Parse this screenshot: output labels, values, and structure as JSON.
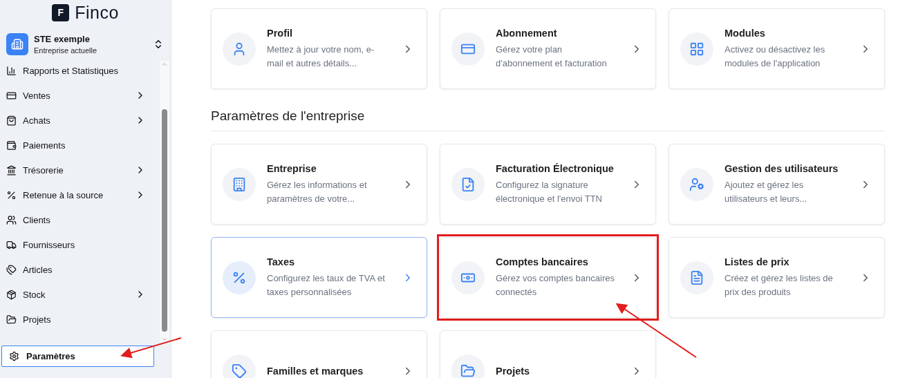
{
  "logo": {
    "mark": "F",
    "name": "Finco"
  },
  "company": {
    "name": "STE exemple",
    "subtitle": "Entreprise actuelle"
  },
  "sidebar": {
    "items": [
      {
        "label": "Rapports et Statistiques",
        "submenu": false,
        "selected": false
      },
      {
        "label": "Ventes",
        "submenu": true,
        "selected": false
      },
      {
        "label": "Achats",
        "submenu": true,
        "selected": false
      },
      {
        "label": "Paiements",
        "submenu": false,
        "selected": false
      },
      {
        "label": "Trésorerie",
        "submenu": true,
        "selected": false
      },
      {
        "label": "Retenue à la source",
        "submenu": true,
        "selected": false
      },
      {
        "label": "Clients",
        "submenu": false,
        "selected": false
      },
      {
        "label": "Fournisseurs",
        "submenu": false,
        "selected": false
      },
      {
        "label": "Articles",
        "submenu": false,
        "selected": false
      },
      {
        "label": "Stock",
        "submenu": true,
        "selected": false
      },
      {
        "label": "Projets",
        "submenu": false,
        "selected": false
      }
    ],
    "footer_item": {
      "label": "Paramètres",
      "selected": true
    }
  },
  "sections": [
    {
      "cards": [
        {
          "title": "Profil",
          "description": "Mettez à jour votre nom, e-mail et autres détails...",
          "hovered": false,
          "highlighted": false
        },
        {
          "title": "Abonnement",
          "description": "Gérez votre plan d'abonnement et facturation",
          "hovered": false,
          "highlighted": false
        },
        {
          "title": "Modules",
          "description": "Activez ou désactivez les modules de l'application",
          "hovered": false,
          "highlighted": false
        }
      ]
    },
    {
      "title": "Paramètres de l'entreprise",
      "cards": [
        {
          "title": "Entreprise",
          "description": "Gérez les informations et paramètres de votre...",
          "hovered": false,
          "highlighted": false
        },
        {
          "title": "Facturation Électronique",
          "description": "Configurez la signature électronique et l'envoi TTN",
          "hovered": false,
          "highlighted": false
        },
        {
          "title": "Gestion des utilisateurs",
          "description": "Ajoutez et gérez les utilisateurs et leurs...",
          "hovered": false,
          "highlighted": false
        },
        {
          "title": "Taxes",
          "description": "Configurez les taux de TVA et taxes personnalisées",
          "hovered": true,
          "highlighted": false
        },
        {
          "title": "Comptes bancaires",
          "description": "Gérez vos comptes bancaires connectés",
          "hovered": false,
          "highlighted": true
        },
        {
          "title": "Listes de prix",
          "description": "Créez et gérez les listes de prix des produits",
          "hovered": false,
          "highlighted": false
        },
        {
          "title": "Familles et marques",
          "hovered": false,
          "highlighted": false
        },
        {
          "title": "Projets",
          "hovered": false,
          "highlighted": false
        }
      ]
    }
  ]
}
